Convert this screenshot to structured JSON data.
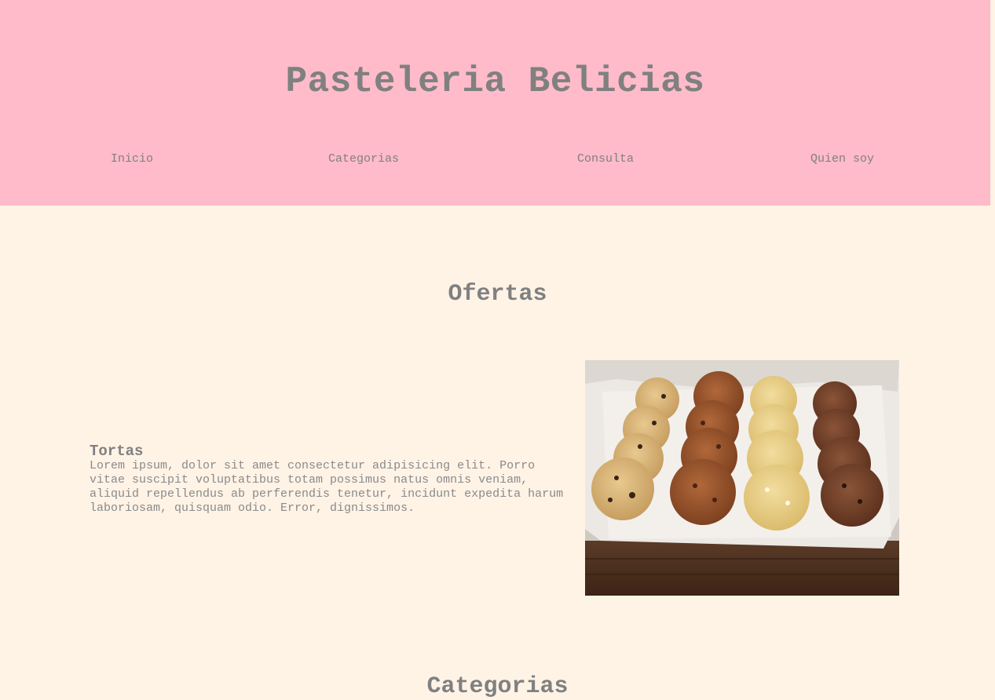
{
  "header": {
    "title": "Pasteleria Belicias",
    "nav": [
      {
        "label": "Inicio"
      },
      {
        "label": "Categorias"
      },
      {
        "label": "Consulta"
      },
      {
        "label": "Quien soy"
      }
    ]
  },
  "offers": {
    "heading": "Ofertas",
    "item": {
      "title": "Tortas",
      "description": "Lorem ipsum, dolor sit amet consectetur adipisicing elit. Porro vitae suscipit voluptatibus totam possimus natus omnis veniam, aliquid repellendus ab perferendis tenetur, incidunt expedita harum laboriosam, quisquam odio. Error, dignissimos."
    }
  },
  "categories": {
    "heading": "Categorias"
  },
  "colors": {
    "header_bg": "#FFBBC9",
    "page_bg": "#FFF3E6",
    "text": "#808080"
  }
}
